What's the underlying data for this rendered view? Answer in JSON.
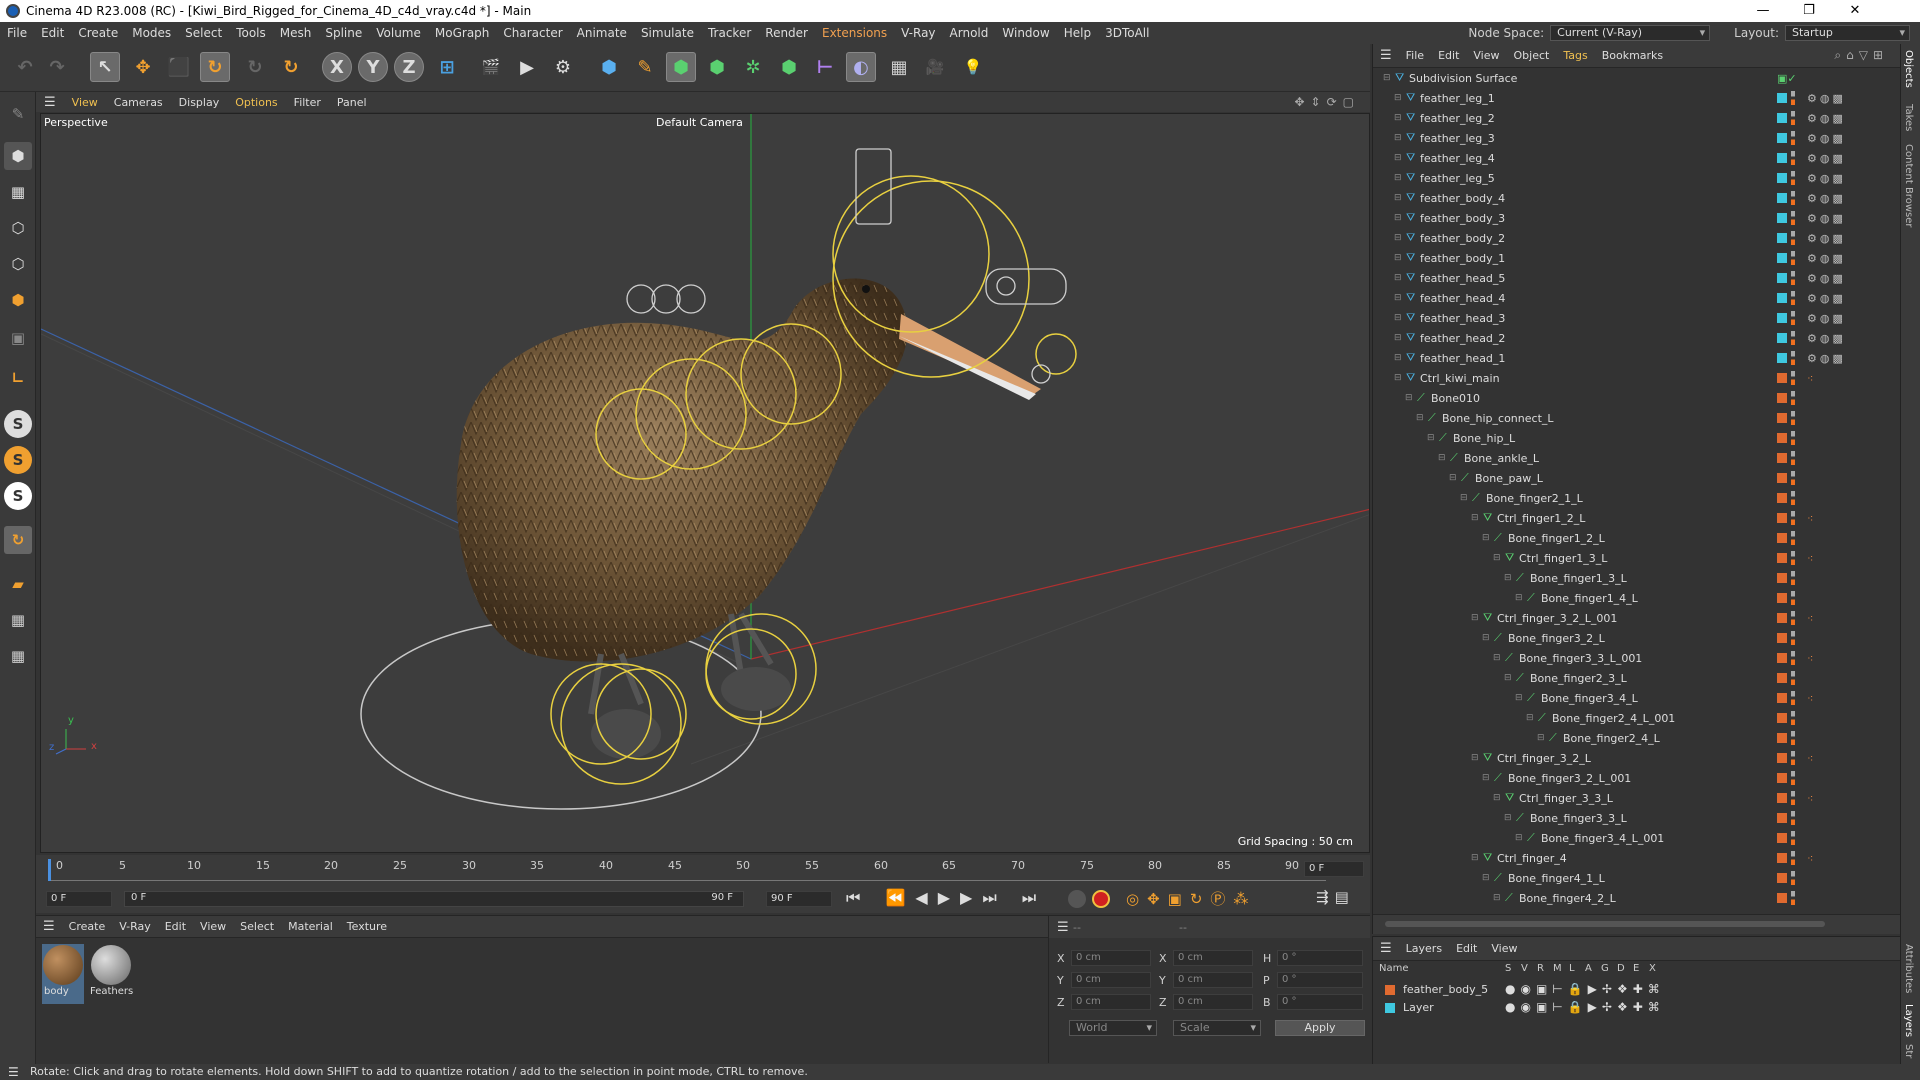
{
  "title": {
    "app_icon": "cinema4d-icon",
    "text": "Cinema 4D R23.008 (RC) - [Kiwi_Bird_Rigged_for_Cinema_4D_c4d_vray.c4d *] - Main",
    "minimize": "—",
    "maximize": "❐",
    "close": "✕"
  },
  "menu": {
    "items": [
      "File",
      "Edit",
      "Create",
      "Modes",
      "Select",
      "Tools",
      "Mesh",
      "Spline",
      "Volume",
      "MoGraph",
      "Character",
      "Animate",
      "Simulate",
      "Tracker",
      "Render",
      "Extensions",
      "V-Ray",
      "Arnold",
      "Window",
      "Help",
      "3DToAll"
    ],
    "node_space_label": "Node Space:",
    "node_space_value": "Current (V-Ray)",
    "layout_label": "Layout:",
    "layout_value": "Startup"
  },
  "toolbar": {
    "undo": "↶",
    "redo": "↷",
    "live": "↖",
    "move": "✥",
    "scale": "⬛",
    "rotate": "↻",
    "recent": "↻",
    "x": "X",
    "y": "Y",
    "z": "Z",
    "coord": "⊞",
    "render_region": "🎬",
    "render_view": "▶",
    "render_settings": "⚙",
    "cube": "⬢",
    "pen": "✎",
    "subdiv": "⬢",
    "extrude": "⬢",
    "cloner": "✲",
    "array": "⬢",
    "deform": "⊢",
    "field": "◐",
    "floor": "▦",
    "camera": "🎥",
    "light": "💡"
  },
  "viewport": {
    "menu": [
      "View",
      "Cameras",
      "Display",
      "Options",
      "Filter",
      "Panel"
    ],
    "label": "Perspective",
    "camera": "Default Camera",
    "grid_spacing": "Grid Spacing : 50 cm",
    "axis_x": "x",
    "axis_y": "y",
    "axis_z": "z"
  },
  "timeline": {
    "ticks": [
      "0",
      "5",
      "10",
      "15",
      "20",
      "25",
      "30",
      "35",
      "40",
      "45",
      "50",
      "55",
      "60",
      "65",
      "70",
      "75",
      "80",
      "85",
      "90"
    ],
    "current_frame": "0 F"
  },
  "transport": {
    "start": "0 F",
    "range_start": "0 F",
    "range_end": "90 F",
    "end": "90 F"
  },
  "materials": {
    "menu": [
      "Create",
      "V-Ray",
      "Edit",
      "View",
      "Select",
      "Material",
      "Texture"
    ],
    "items": [
      {
        "name": "body"
      },
      {
        "name": "Feathers"
      }
    ]
  },
  "coords": {
    "labels": {
      "x": "X",
      "y": "Y",
      "z": "Z",
      "x2": "X",
      "y2": "Y",
      "z2": "Z",
      "h": "H",
      "p": "P",
      "b": "B"
    },
    "pos": [
      "0 cm",
      "0 cm",
      "0 cm"
    ],
    "size": [
      "0 cm",
      "0 cm",
      "0 cm"
    ],
    "rot": [
      "0 °",
      "0 °",
      "0 °"
    ],
    "mode": "World",
    "size_mode": "Scale",
    "apply": "Apply",
    "dash1": "--",
    "dash2": "--"
  },
  "objects": {
    "menu": [
      "File",
      "Edit",
      "View",
      "Object",
      "Tags",
      "Bookmarks"
    ],
    "rows": [
      {
        "name": "Subdivision Surface",
        "depth": 0,
        "color": "#3fb0d0"
      },
      {
        "name": "feather_leg_1",
        "depth": 1,
        "color": "#3fc8e0"
      },
      {
        "name": "feather_leg_2",
        "depth": 1,
        "color": "#3fc8e0"
      },
      {
        "name": "feather_leg_3",
        "depth": 1,
        "color": "#3fc8e0"
      },
      {
        "name": "feather_leg_4",
        "depth": 1,
        "color": "#3fc8e0"
      },
      {
        "name": "feather_leg_5",
        "depth": 1,
        "color": "#3fc8e0"
      },
      {
        "name": "feather_body_4",
        "depth": 1,
        "color": "#3fc8e0"
      },
      {
        "name": "feather_body_3",
        "depth": 1,
        "color": "#3fc8e0"
      },
      {
        "name": "feather_body_2",
        "depth": 1,
        "color": "#3fc8e0"
      },
      {
        "name": "feather_body_1",
        "depth": 1,
        "color": "#3fc8e0"
      },
      {
        "name": "feather_head_5",
        "depth": 1,
        "color": "#3fc8e0"
      },
      {
        "name": "feather_head_4",
        "depth": 1,
        "color": "#3fc8e0"
      },
      {
        "name": "feather_head_3",
        "depth": 1,
        "color": "#3fc8e0"
      },
      {
        "name": "feather_head_2",
        "depth": 1,
        "color": "#3fc8e0"
      },
      {
        "name": "feather_head_1",
        "depth": 1,
        "color": "#3fc8e0"
      },
      {
        "name": "Ctrl_kiwi_main",
        "depth": 1,
        "color": "#e06a30"
      },
      {
        "name": "Bone010",
        "depth": 2,
        "color": "#e06a30"
      },
      {
        "name": "Bone_hip_connect_L",
        "depth": 3,
        "color": "#e06a30"
      },
      {
        "name": "Bone_hip_L",
        "depth": 4,
        "color": "#e06a30"
      },
      {
        "name": "Bone_ankle_L",
        "depth": 5,
        "color": "#e06a30"
      },
      {
        "name": "Bone_paw_L",
        "depth": 6,
        "color": "#e06a30"
      },
      {
        "name": "Bone_finger2_1_L",
        "depth": 7,
        "color": "#e06a30"
      },
      {
        "name": "Ctrl_finger1_2_L",
        "depth": 8,
        "color": "#e06a30"
      },
      {
        "name": "Bone_finger1_2_L",
        "depth": 9,
        "color": "#e06a30"
      },
      {
        "name": "Ctrl_finger1_3_L",
        "depth": 10,
        "color": "#e06a30"
      },
      {
        "name": "Bone_finger1_3_L",
        "depth": 11,
        "color": "#e06a30"
      },
      {
        "name": "Bone_finger1_4_L",
        "depth": 12,
        "color": "#e06a30"
      },
      {
        "name": "Ctrl_finger_3_2_L_001",
        "depth": 8,
        "color": "#e06a30"
      },
      {
        "name": "Bone_finger3_2_L",
        "depth": 9,
        "color": "#e06a30"
      },
      {
        "name": "Bone_finger3_3_L_001",
        "depth": 10,
        "color": "#e06a30"
      },
      {
        "name": "Bone_finger2_3_L",
        "depth": 11,
        "color": "#e06a30"
      },
      {
        "name": "Bone_finger3_4_L",
        "depth": 12,
        "color": "#e06a30"
      },
      {
        "name": "Bone_finger2_4_L_001",
        "depth": 13,
        "color": "#e06a30"
      },
      {
        "name": "Bone_finger2_4_L",
        "depth": 14,
        "color": "#e06a30"
      },
      {
        "name": "Ctrl_finger_3_2_L",
        "depth": 8,
        "color": "#e06a30"
      },
      {
        "name": "Bone_finger3_2_L_001",
        "depth": 9,
        "color": "#e06a30"
      },
      {
        "name": "Ctrl_finger_3_3_L",
        "depth": 10,
        "color": "#e06a30"
      },
      {
        "name": "Bone_finger3_3_L",
        "depth": 11,
        "color": "#e06a30"
      },
      {
        "name": "Bone_finger3_4_L_001",
        "depth": 12,
        "color": "#e06a30"
      },
      {
        "name": "Ctrl_finger_4",
        "depth": 8,
        "color": "#e06a30"
      },
      {
        "name": "Bone_finger4_1_L",
        "depth": 9,
        "color": "#e06a30"
      },
      {
        "name": "Bone_finger4_2_L",
        "depth": 10,
        "color": "#e06a30"
      }
    ]
  },
  "layers": {
    "menu": [
      "Layers",
      "Edit",
      "View"
    ],
    "header": {
      "name": "Name",
      "cols": [
        "S",
        "V",
        "R",
        "M",
        "L",
        "A",
        "G",
        "D",
        "E",
        "X"
      ]
    },
    "rows": [
      {
        "name": "feather_body_5",
        "color": "#e06a30"
      },
      {
        "name": "Layer",
        "color": "#3fc8e0"
      }
    ]
  },
  "side_tabs": [
    "Objects",
    "Takes",
    "Content Browser",
    "Attributes",
    "Layers",
    "Str"
  ],
  "status": "Rotate: Click and drag to rotate elements. Hold down SHIFT to add to quantize rotation / add to the selection in point mode, CTRL to remove."
}
